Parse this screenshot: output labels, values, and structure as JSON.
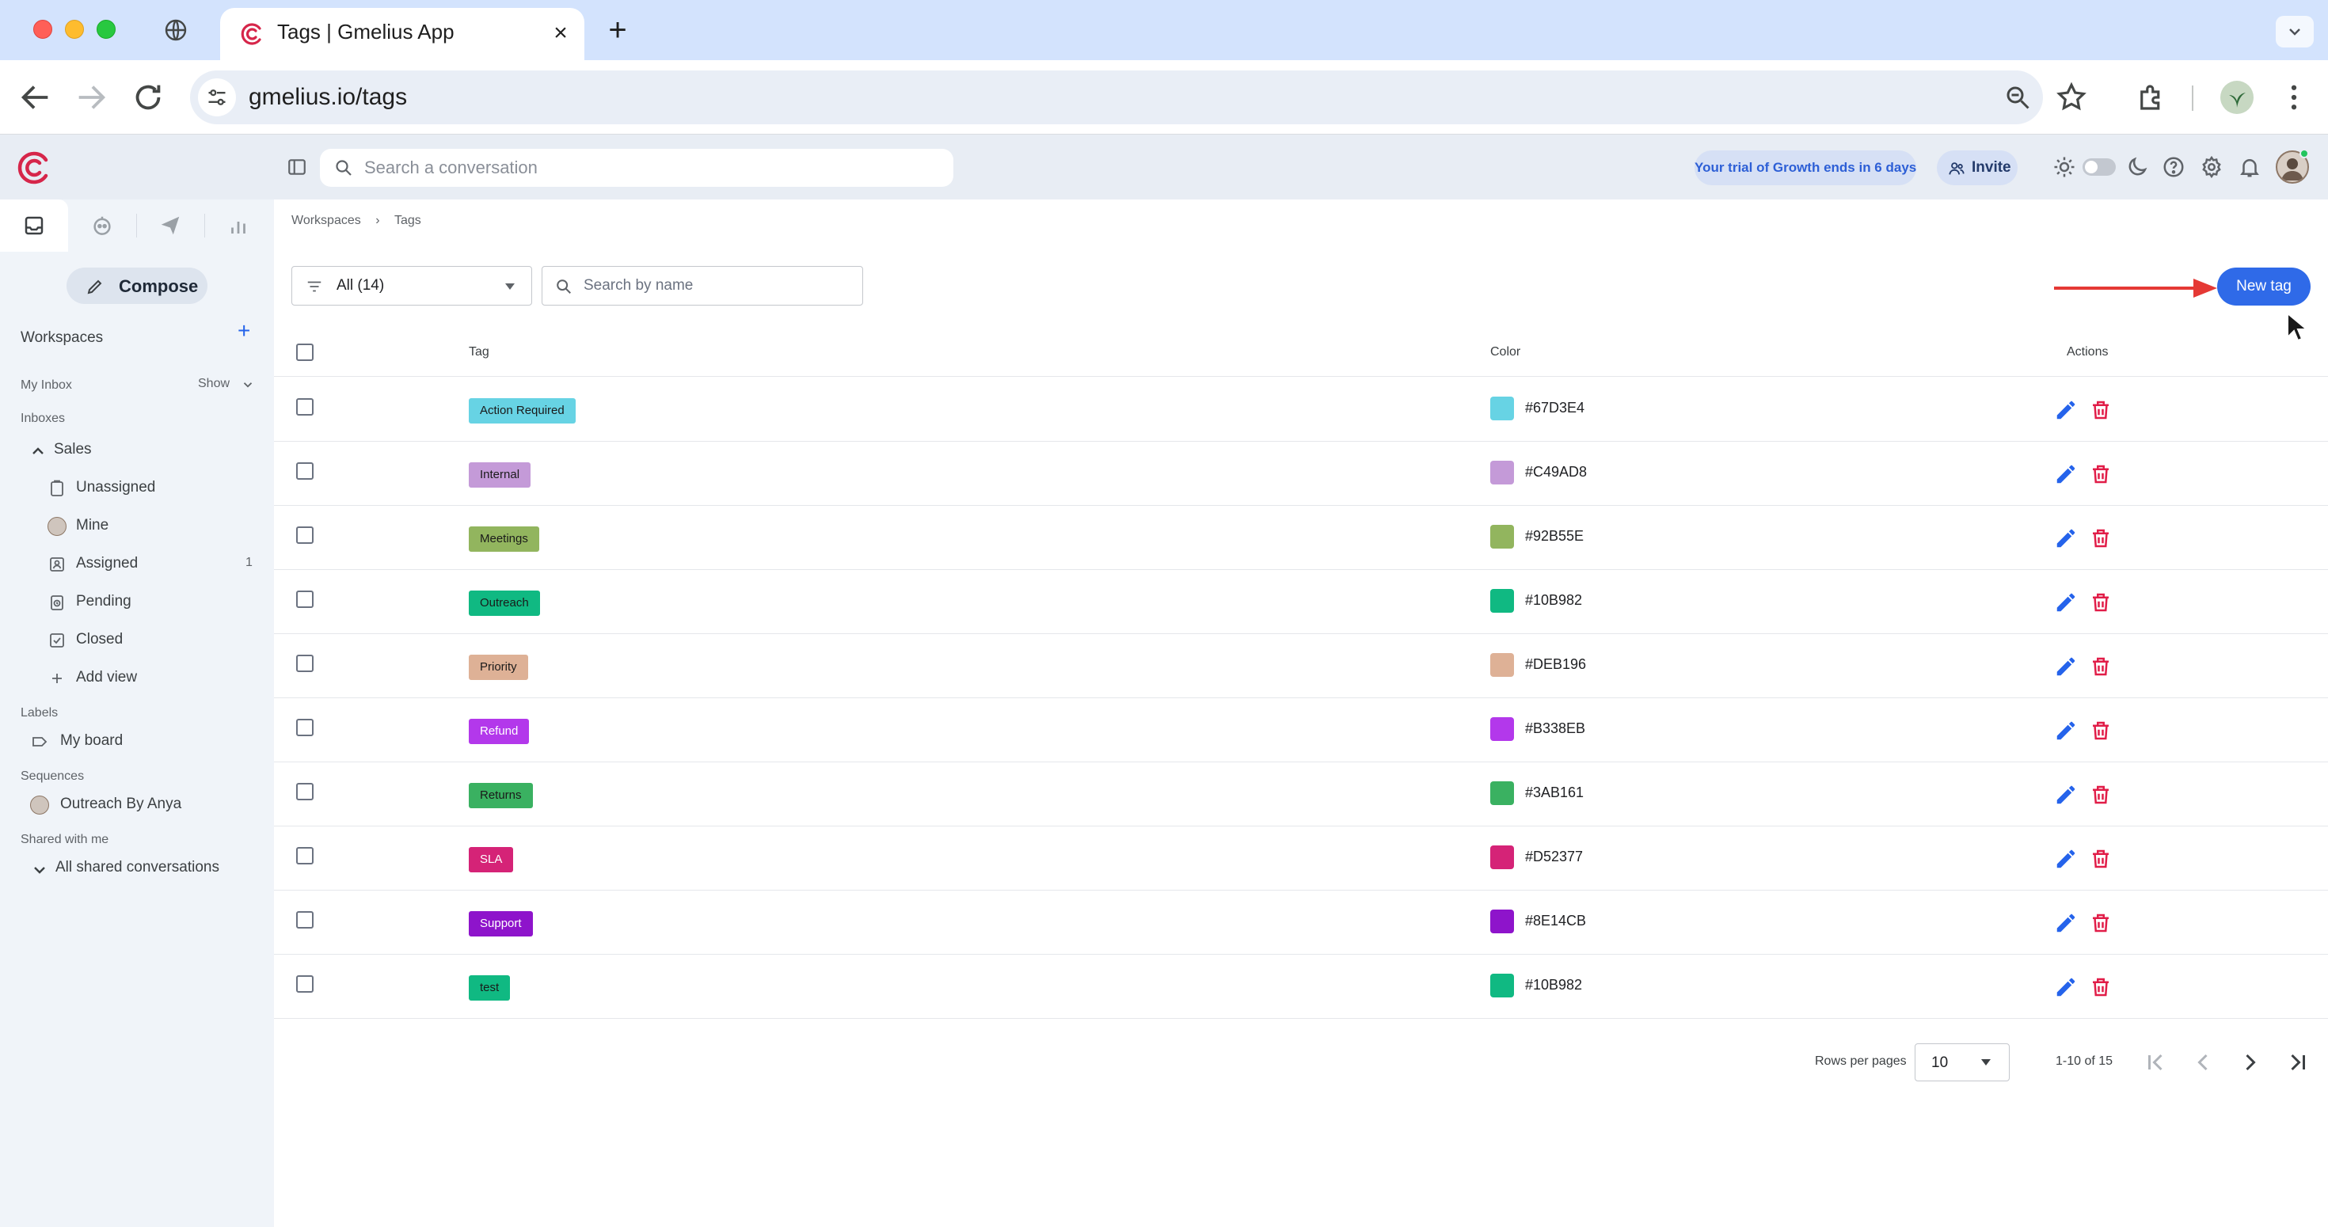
{
  "browser": {
    "tab_title": "Tags | Gmelius App",
    "url": "gmelius.io/tags"
  },
  "header": {
    "search_placeholder": "Search a conversation",
    "trial_text": "Your trial of Growth ends in 6 days",
    "invite_label": "Invite"
  },
  "sidebar": {
    "compose_label": "Compose",
    "workspaces_label": "Workspaces",
    "my_inbox_label": "My Inbox",
    "show_label": "Show",
    "inboxes_label": "Inboxes",
    "sales_label": "Sales",
    "items": [
      {
        "label": "Unassigned",
        "count": ""
      },
      {
        "label": "Mine",
        "count": ""
      },
      {
        "label": "Assigned",
        "count": "1"
      },
      {
        "label": "Pending",
        "count": ""
      },
      {
        "label": "Closed",
        "count": ""
      },
      {
        "label": "Add view",
        "count": ""
      }
    ],
    "labels_label": "Labels",
    "my_board_label": "My board",
    "sequences_label": "Sequences",
    "sequence_item": "Outreach By Anya",
    "shared_label": "Shared with me",
    "shared_item": "All shared conversations"
  },
  "main": {
    "breadcrumb": [
      "Workspaces",
      "Tags"
    ],
    "filter_value": "All (14)",
    "search_placeholder": "Search by name",
    "new_tag_label": "New tag",
    "columns": {
      "tag": "Tag",
      "color": "Color",
      "actions": "Actions"
    },
    "rows": [
      {
        "tag": "Action Required",
        "hex": "#67D3E4",
        "color": "#67D3E4"
      },
      {
        "tag": "Internal",
        "hex": "#C49AD8",
        "color": "#C49AD8"
      },
      {
        "tag": "Meetings",
        "hex": "#92B55E",
        "color": "#92B55E"
      },
      {
        "tag": "Outreach",
        "hex": "#10B982",
        "color": "#10B982"
      },
      {
        "tag": "Priority",
        "hex": "#DEB196",
        "color": "#DEB196"
      },
      {
        "tag": "Refund",
        "hex": "#B338EB",
        "color": "#B338EB"
      },
      {
        "tag": "Returns",
        "hex": "#3AB161",
        "color": "#3AB161"
      },
      {
        "tag": "SLA",
        "hex": "#D52377",
        "color": "#D52377"
      },
      {
        "tag": "Support",
        "hex": "#8E14CB",
        "color": "#8E14CB"
      },
      {
        "tag": "test",
        "hex": "#10B982",
        "color": "#10B982"
      }
    ],
    "pagination": {
      "rows_per_page_label": "Rows per pages",
      "rows_per_page_value": "10",
      "range": "1-10 of 15"
    }
  },
  "colors": {
    "accent": "#2F6AE8",
    "delete": "#E11D48",
    "edit": "#2563EB",
    "annotation_arrow": "#E53935"
  }
}
